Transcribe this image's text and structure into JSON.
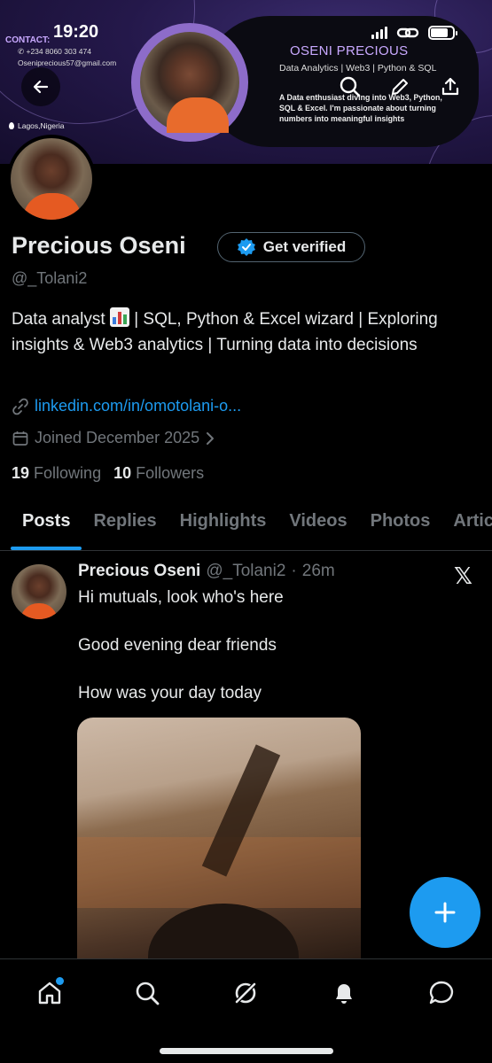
{
  "status_bar": {
    "time": "19:20"
  },
  "banner": {
    "contact_title": "CONTACT:",
    "phone": "+234 8060 303 474",
    "email": "Oseniprecious57@gmail.com",
    "location": "Lagos,Nigeria",
    "name": "OSENI PRECIOUS",
    "subtitle": "Data Analytics | Web3 | Python & SQL",
    "bio": "A Data enthusiast diving into Web3, Python, SQL & Excel. I'm passionate about turning numbers into meaningful insights"
  },
  "profile": {
    "name": "Precious Oseni",
    "verify_label": "Get verified",
    "handle": "@_Tolani2",
    "bio_part1": "Data analyst",
    "bio_part2": "| SQL, Python & Excel wizard | Exploring insights & Web3 analytics | Turning data into decisions",
    "link": "linkedin.com/in/omotolani-o...",
    "joined": "Joined December 2025",
    "following_count": "19",
    "following_label": "Following",
    "followers_count": "10",
    "followers_label": "Followers"
  },
  "tabs": [
    "Posts",
    "Replies",
    "Highlights",
    "Videos",
    "Photos",
    "Articles"
  ],
  "post": {
    "author": "Precious Oseni",
    "handle": "@_Tolani2",
    "separator": "·",
    "time": "26m",
    "line1": "Hi mutuals, look who's here",
    "line2": "Good evening dear friends",
    "line3": "How was your day today"
  },
  "icons": {
    "back": "arrow-left-icon",
    "search": "search-icon",
    "edit": "pencil-icon",
    "share": "share-icon",
    "verified": "verified-badge-icon",
    "link": "link-icon",
    "calendar": "calendar-icon",
    "compose": "plus-icon"
  },
  "colors": {
    "accent": "#1d9bf0",
    "background": "#000000",
    "text": "#e7e9ea",
    "muted": "#71767b",
    "banner_accent": "#c9a9ff"
  }
}
